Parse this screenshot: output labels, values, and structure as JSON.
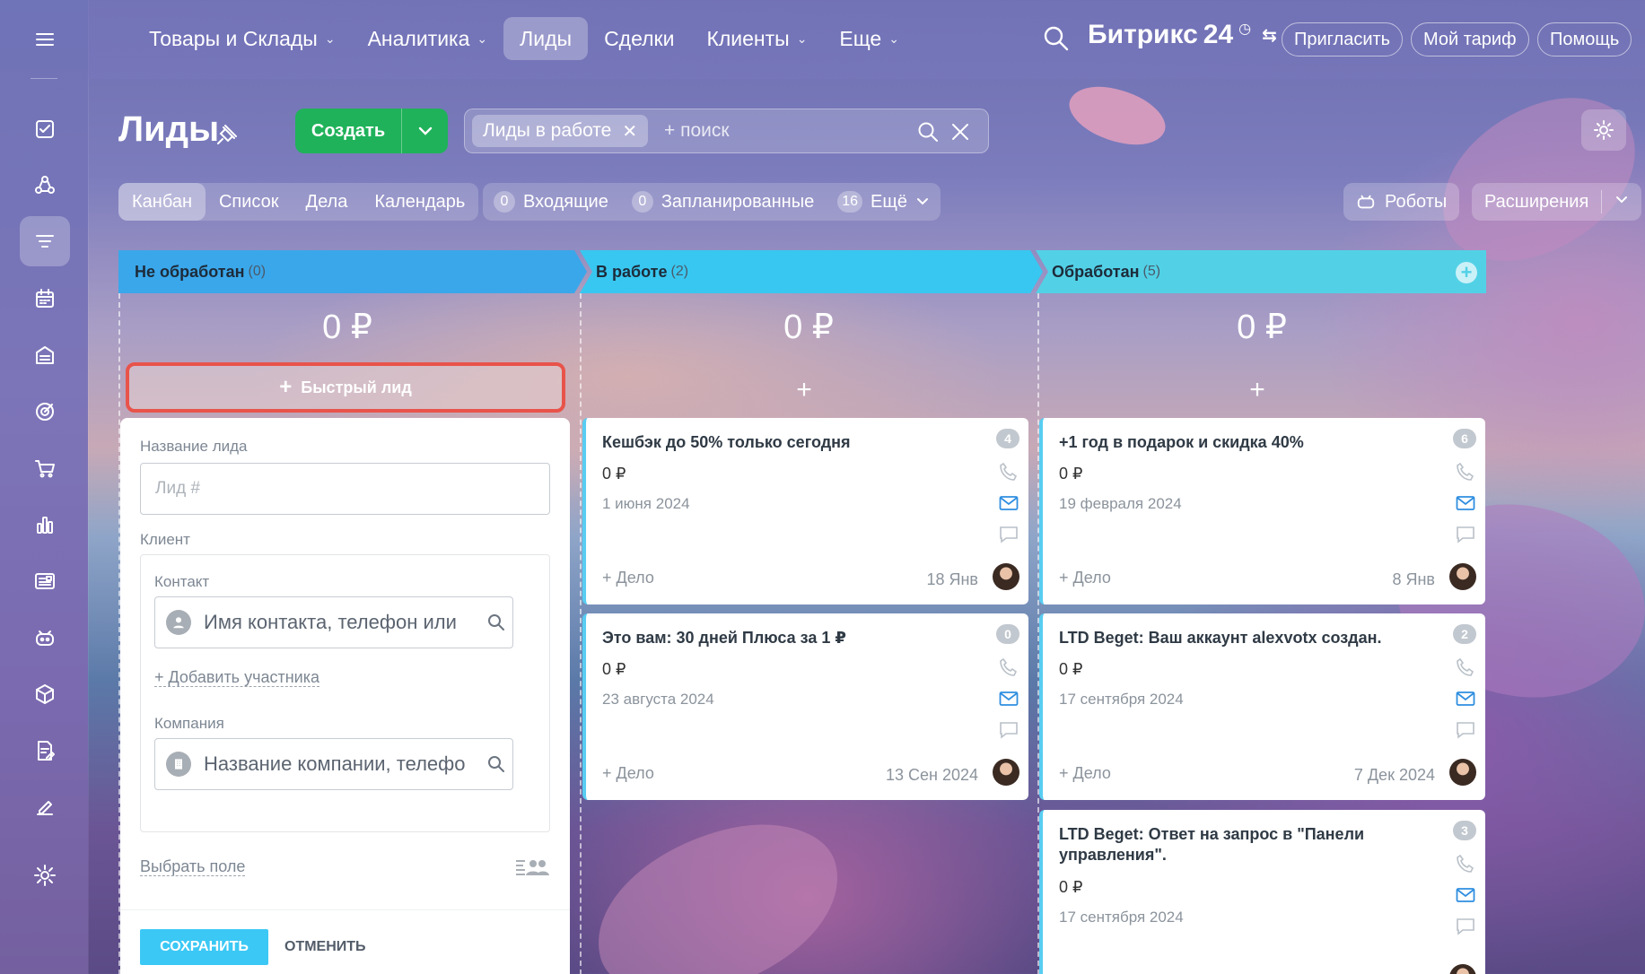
{
  "topnav": {
    "items": [
      {
        "label": "Товары и Склады",
        "has_menu": true,
        "active": false
      },
      {
        "label": "Аналитика",
        "has_menu": true,
        "active": false
      },
      {
        "label": "Лиды",
        "has_menu": false,
        "active": true
      },
      {
        "label": "Сделки",
        "has_menu": false,
        "active": false
      },
      {
        "label": "Клиенты",
        "has_menu": true,
        "active": false
      },
      {
        "label": "Еще",
        "has_menu": true,
        "active": false
      }
    ],
    "brand_name": "Битрикс",
    "brand_number": "24",
    "invite_label": "Пригласить",
    "tariff_label": "Мой тариф",
    "help_label": "Помощь"
  },
  "sidebar": {
    "icons": [
      "menu-icon",
      "tasks-icon",
      "feed-icon",
      "crm-icon",
      "calendar-icon",
      "store-icon",
      "marketing-icon",
      "shop-icon",
      "analytics-icon",
      "sites-icon",
      "robot-icon",
      "inventory-icon",
      "docs-icon",
      "sign-icon",
      "settings-icon"
    ],
    "active": "crm-icon"
  },
  "page": {
    "title": "Лиды",
    "create_label": "Создать",
    "filter_chip": "Лиды в работе",
    "search_placeholder": "+ поиск"
  },
  "views": {
    "items": [
      "Канбан",
      "Список",
      "Дела",
      "Календарь"
    ],
    "active": "Канбан"
  },
  "counters": [
    {
      "count": "0",
      "label": "Входящие"
    },
    {
      "count": "0",
      "label": "Запланированные"
    },
    {
      "count": "16",
      "label": "Ещё"
    }
  ],
  "robots_label": "Роботы",
  "extensions_label": "Расширения",
  "columns": [
    {
      "title": "Не обработан",
      "count": "(0)",
      "sum": "0 ₽",
      "color": "#3aa7ea"
    },
    {
      "title": "В работе",
      "count": "(2)",
      "sum": "0 ₽",
      "color": "#38c7f0"
    },
    {
      "title": "Обработан",
      "count": "(5)",
      "sum": "0 ₽",
      "color": "#52d1e6"
    }
  ],
  "quick_lead": {
    "button_label": "Быстрый лид",
    "name_label": "Название лида",
    "name_placeholder": "Лид #",
    "client_label": "Клиент",
    "contact_label": "Контакт",
    "contact_placeholder": "Имя контакта, телефон или",
    "add_participant": "+ Добавить участника",
    "company_label": "Компания",
    "company_placeholder": "Название компании, телефо",
    "choose_field": "Выбрать поле",
    "save_label": "СОХРАНИТЬ",
    "cancel_label": "ОТМЕНИТЬ"
  },
  "cards": {
    "in_work": [
      {
        "title": "Кешбэк до 50% только сегодня",
        "price": "0 ₽",
        "date": "1 июня 2024",
        "deal": "+ Дело",
        "when": "18 Янв",
        "badge": "4"
      },
      {
        "title": "Это вам: 30 дней Плюса за 1 ₽",
        "price": "0 ₽",
        "date": "23 августа 2024",
        "deal": "+ Дело",
        "when": "13 Сен 2024",
        "badge": "0"
      }
    ],
    "processed": [
      {
        "title": "+1 год в подарок и скидка 40%",
        "price": "0 ₽",
        "date": "19 февраля 2024",
        "deal": "+ Дело",
        "when": "8 Янв",
        "badge": "6"
      },
      {
        "title": "LTD Beget: Ваш аккаунт alexvotx создан.",
        "price": "0 ₽",
        "date": "17 сентября 2024",
        "deal": "+ Дело",
        "when": "7 Дек 2024",
        "badge": "2"
      },
      {
        "title": "LTD Beget: Ответ на запрос в \"Панели управления\".",
        "price": "0 ₽",
        "date": "17 сентября 2024",
        "deal": "",
        "when": "",
        "badge": "3"
      }
    ]
  },
  "colors": {
    "accent_green": "#1fb25a",
    "quick_lead_outline": "#e8534a",
    "save_blue": "#3bc8f5",
    "mail_icon_blue": "#2f8ee0"
  }
}
